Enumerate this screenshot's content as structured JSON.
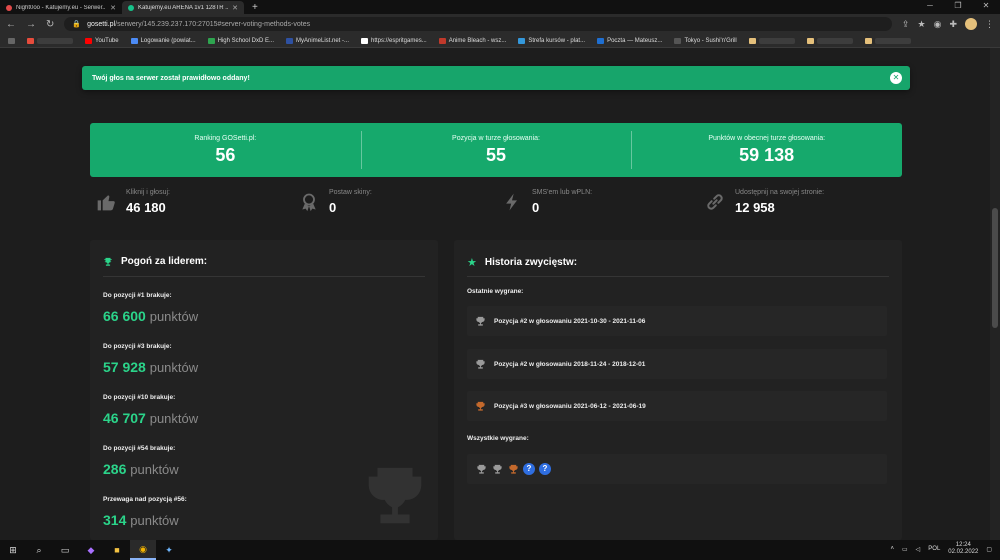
{
  "browser": {
    "tabs": [
      {
        "title": "Night0oo - Katujemy.eu - Serwer...",
        "active": false,
        "color": "#e24a4a"
      },
      {
        "title": "Katujemy.eu ARENA 1v1 128TR ...",
        "active": true,
        "color": "#17c28a"
      }
    ],
    "new_tab": "+",
    "url_host": "gosetti.pl",
    "url_path": "/serwery/145.239.237.170:27015#server-voting-methods-votes",
    "bookmarks": [
      {
        "label": "",
        "color": "#e74c3c"
      },
      {
        "label": "YouTube",
        "color": "#ff0000"
      },
      {
        "label": "Logowanie (powiat...",
        "color": "#4c8bf5"
      },
      {
        "label": "High School DxD E...",
        "color": "#2ea44f"
      },
      {
        "label": "MyAnimeList.net -...",
        "color": "#2e51a2"
      },
      {
        "label": "https://espritgames...",
        "color": "#ffffff"
      },
      {
        "label": "Anime Bleach - wsz...",
        "color": "#c0392b"
      },
      {
        "label": "Strefa kursów - plat...",
        "color": "#3498db"
      },
      {
        "label": "Poczta — Mateusz...",
        "color": "#1f6fd1"
      },
      {
        "label": "Tokyo - Sushi'n'Grill",
        "color": "#555555"
      }
    ]
  },
  "notice": {
    "text": "Twój głos na serwer został prawidłowo oddany!",
    "close": "✕"
  },
  "stats": [
    {
      "label": "Ranking GOSetti.pl:",
      "value": "56"
    },
    {
      "label": "Pozycja w turze głosowania:",
      "value": "55"
    },
    {
      "label": "Punktów w obecnej turze głosowania:",
      "value": "59 138"
    }
  ],
  "mini_stats": [
    {
      "label": "Kliknij i głosuj:",
      "value": "46 180",
      "icon": "thumbs-up-icon"
    },
    {
      "label": "Postaw skiny:",
      "value": "0",
      "icon": "award-icon"
    },
    {
      "label": "SMS'em lub wPLN:",
      "value": "0",
      "icon": "bolt-icon"
    },
    {
      "label": "Udostępnij na swojej stronie:",
      "value": "12 958",
      "icon": "link-icon"
    }
  ],
  "leader": {
    "title": "Pogoń za liderem:",
    "rows": [
      {
        "label": "Do pozycji #1 brakuje:",
        "value": "66 600",
        "unit": "punktów"
      },
      {
        "label": "Do pozycji #3 brakuje:",
        "value": "57 928",
        "unit": "punktów"
      },
      {
        "label": "Do pozycji #10 brakuje:",
        "value": "46 707",
        "unit": "punktów"
      },
      {
        "label": "Do pozycji #54 brakuje:",
        "value": "286",
        "unit": "punktów"
      },
      {
        "label": "Przewaga nad pozycją #56:",
        "value": "314",
        "unit": "punktów"
      }
    ]
  },
  "history": {
    "title": "Historia zwycięstw:",
    "recent_label": "Ostatnie wygrane:",
    "wins": [
      {
        "text": "Pozycja #2 w głosowaniu 2021-10-30 - 2021-11-06",
        "trophy": "silver"
      },
      {
        "text": "Pozycja #2 w głosowaniu 2018-11-24 - 2018-12-01",
        "trophy": "silver"
      },
      {
        "text": "Pozycja #3 w głosowaniu 2021-06-12 - 2021-06-19",
        "trophy": "bronze"
      }
    ],
    "all_label": "Wszystkie wygrane:",
    "all_unknown": "?"
  },
  "taskbar": {
    "lang": "POL",
    "time": "12:24",
    "date": "02.02.2022"
  },
  "colors": {
    "accent": "#16a96c",
    "accent_text": "#2bd48a",
    "silver": "#9a9a9a",
    "bronze": "#c4692c",
    "unknown": "#2f6ee0"
  }
}
